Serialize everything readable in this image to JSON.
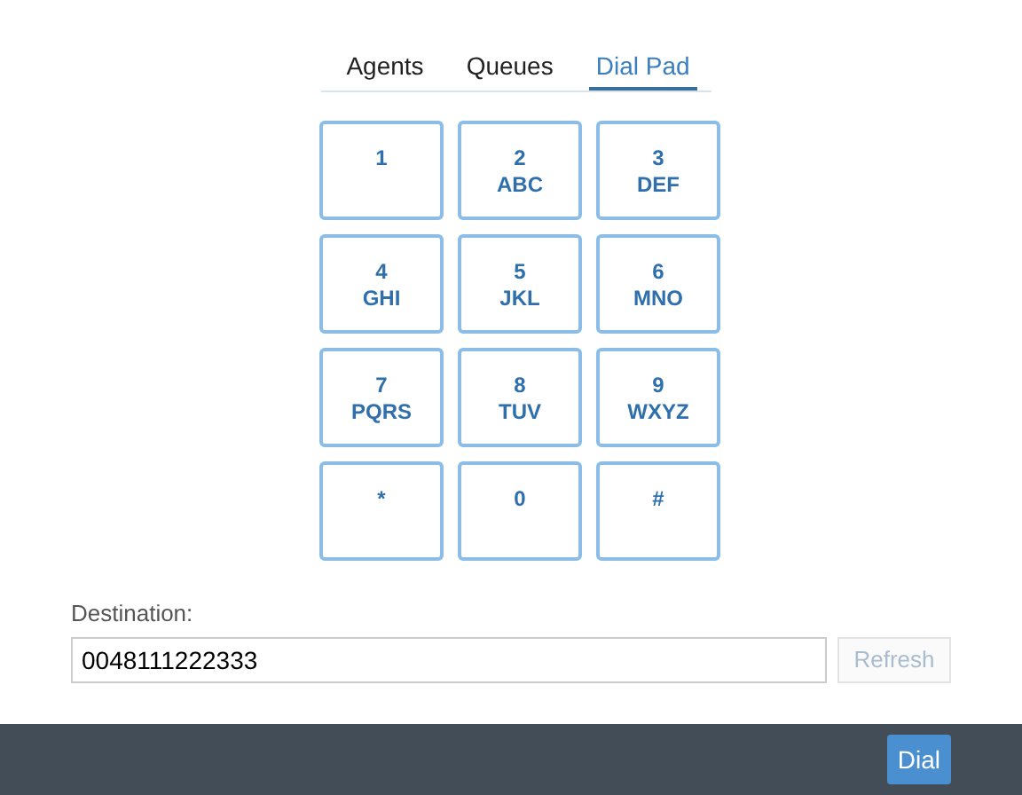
{
  "tabs": [
    {
      "label": "Agents",
      "selected": false
    },
    {
      "label": "Queues",
      "selected": false
    },
    {
      "label": "Dial Pad",
      "selected": true
    }
  ],
  "keypad": [
    {
      "digit": "1"
    },
    {
      "digit": "2",
      "letters": "ABC"
    },
    {
      "digit": "3",
      "letters": "DEF"
    },
    {
      "digit": "4",
      "letters": "GHI"
    },
    {
      "digit": "5",
      "letters": "JKL"
    },
    {
      "digit": "6",
      "letters": "MNO"
    },
    {
      "digit": "7",
      "letters": "PQRS"
    },
    {
      "digit": "8",
      "letters": "TUV"
    },
    {
      "digit": "9",
      "letters": "WXYZ"
    },
    {
      "digit": "*"
    },
    {
      "digit": "0"
    },
    {
      "digit": "#"
    }
  ],
  "destination": {
    "label": "Destination:",
    "value": "0048111222333"
  },
  "refresh_button": {
    "label": "Refresh",
    "disabled": true
  },
  "footer": {
    "dial_button": "Dial"
  }
}
